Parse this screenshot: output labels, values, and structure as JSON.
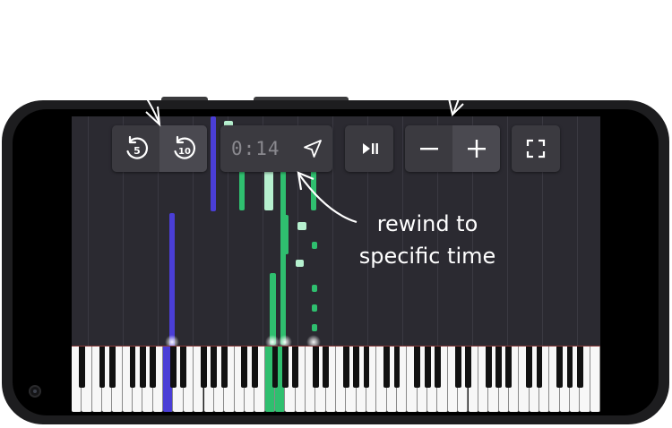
{
  "controls": {
    "rewind_5": {
      "label": "5",
      "icon": "rewind-5-icon"
    },
    "rewind_10": {
      "label": "10",
      "icon": "rewind-10-icon"
    },
    "time": {
      "value": "0:14",
      "icon": "send-arrow-icon"
    },
    "play_pause": {
      "icon": "play-pause-icon"
    },
    "zoom_out": {
      "icon": "minus-icon"
    },
    "zoom_in": {
      "icon": "plus-icon"
    },
    "fullscreen": {
      "icon": "fullscreen-icon"
    }
  },
  "annotation": {
    "line1": "rewind to",
    "line2": "specific time"
  },
  "colors": {
    "background": "#2b2a31",
    "note_green": "#2fbf6f",
    "note_light": "#b6f0cf",
    "note_purple": "#4a3ed6",
    "control_bg": "#3b3a40"
  }
}
